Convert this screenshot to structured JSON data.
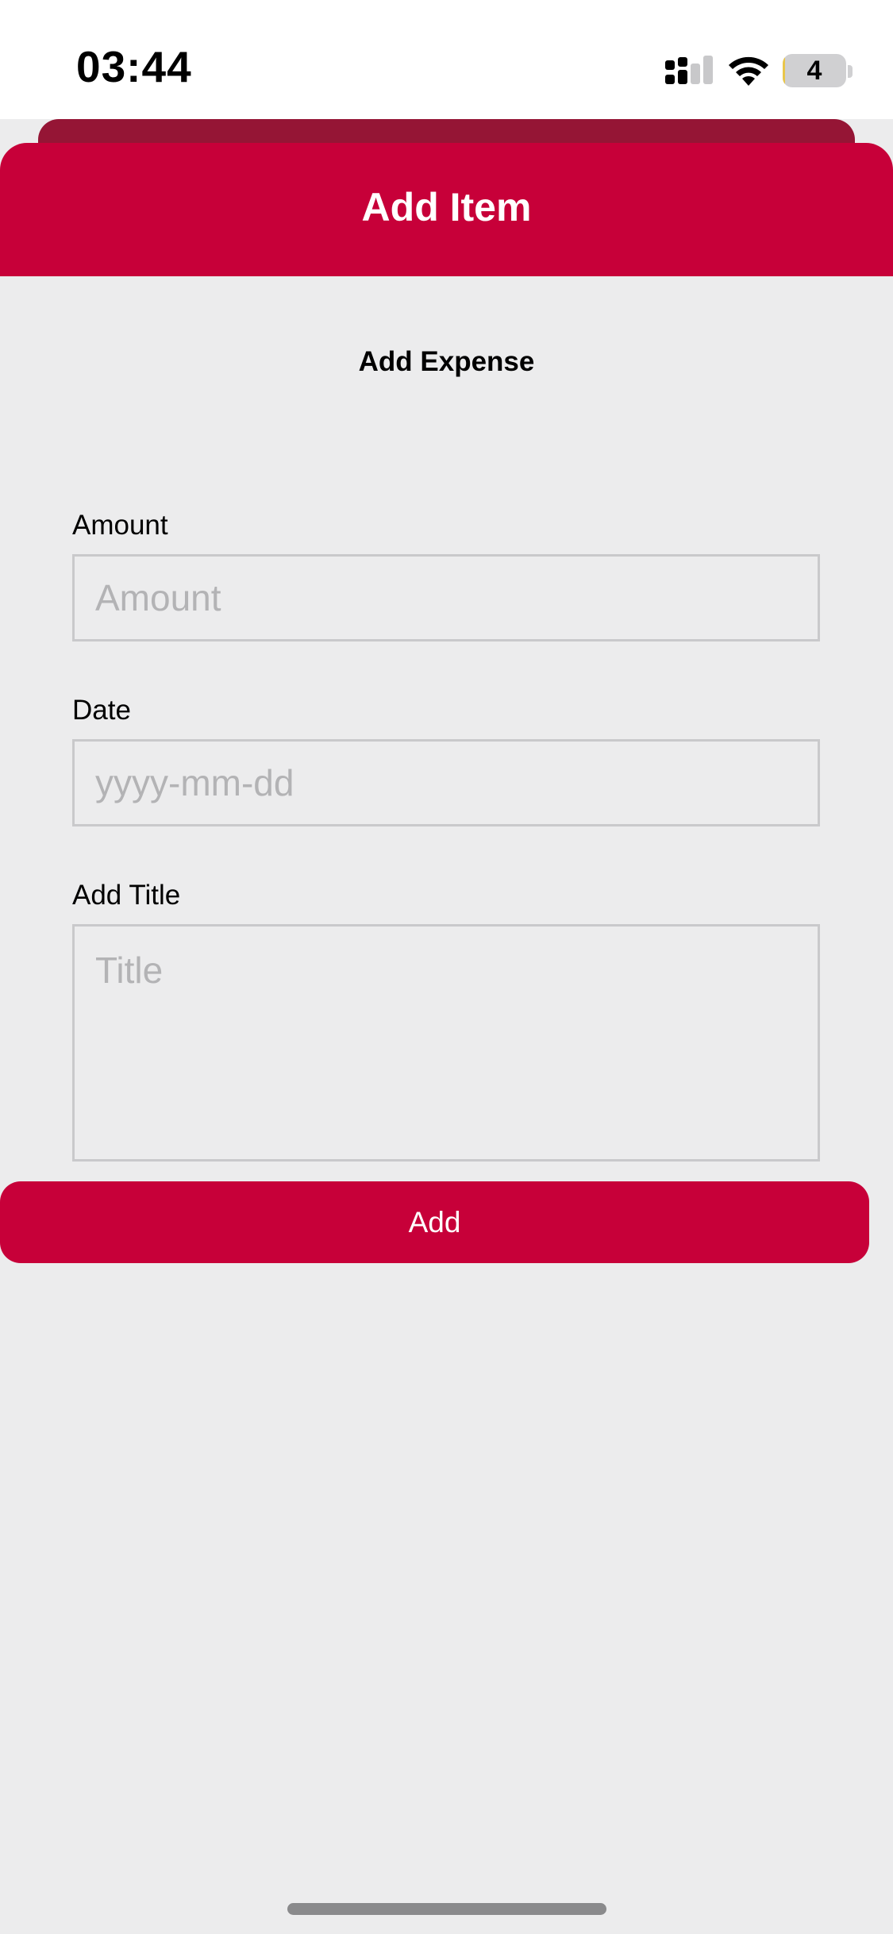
{
  "status_bar": {
    "time": "03:44",
    "battery_level": "4",
    "battery_fraction": 0.04,
    "icons": [
      "signal-icon",
      "wifi-icon",
      "battery-icon"
    ]
  },
  "header": {
    "title": "Add Item"
  },
  "form": {
    "section_title": "Add Expense",
    "amount": {
      "label": "Amount",
      "placeholder": "Amount",
      "value": ""
    },
    "date": {
      "label": "Date",
      "placeholder": "yyyy-mm-dd",
      "value": ""
    },
    "title": {
      "label": "Add Title",
      "placeholder": "Title",
      "value": ""
    },
    "submit_label": "Add"
  },
  "colors": {
    "accent": "#C70039",
    "accent_dark": "#951535",
    "background": "#ECECED",
    "input_border": "#C9C9CB",
    "placeholder": "#B3B3B5"
  }
}
